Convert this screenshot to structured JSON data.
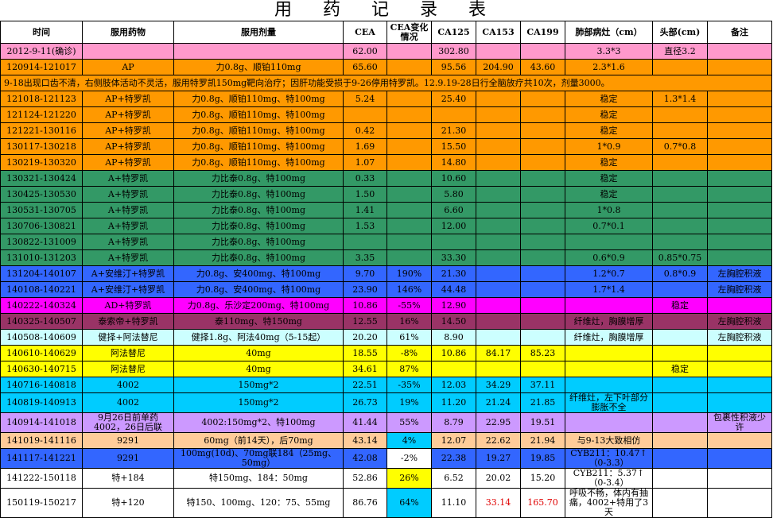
{
  "title": "用 药 记 录 表",
  "headers": [
    "时间",
    "服用药物",
    "服用剂量",
    "CEA",
    "CEA变化情况",
    "CA125",
    "CA153",
    "CA199",
    "肺部病灶（cm）",
    "头部(cm)",
    "备注"
  ],
  "colors": {
    "pink": "#ff99cc",
    "orange": "#ff9900",
    "green": "#339966",
    "blue": "#3366ff",
    "magenta": "#ff00ff",
    "plum": "#993366",
    "lightcyan": "#ccffff",
    "yellow": "#ffff00",
    "cyan": "#00ccff",
    "lavender": "#cc99ff",
    "peach": "#ffcc99",
    "white": "#ffffff"
  },
  "rows": [
    {
      "bg": "pink",
      "cells": [
        "2012-9-11(确诊)",
        "",
        "",
        "62.00",
        "",
        "302.80",
        "",
        "",
        "3.3*3",
        "直径3.2",
        ""
      ]
    },
    {
      "bg": "orange",
      "cells": [
        "120914-121017",
        "AP",
        "力0.8g、顺铂110mg",
        "65.60",
        "",
        "95.56",
        "204.90",
        "43.60",
        "2.3*1.6",
        "",
        ""
      ]
    },
    {
      "bg": "orange",
      "note": "9-18出现口齿不清，右侧肢体活动不灵活，服用特罗凯150mg靶向治疗；因肝功能受损于9-26停用特罗凯。12.9.19-28日行全脑放疗共10次，剂量3000。"
    },
    {
      "bg": "orange",
      "cells": [
        "121018-121123",
        "AP+特罗凯",
        "力0.8g、顺铂110mg、特100mg",
        "5.24",
        "",
        "25.40",
        "",
        "",
        "稳定",
        "1.3*1.4",
        ""
      ]
    },
    {
      "bg": "orange",
      "cells": [
        "121124-121220",
        "AP+特罗凯",
        "力0.8g、顺铂110mg、特100mg",
        "",
        "",
        "",
        "",
        "",
        "稳定",
        "",
        ""
      ]
    },
    {
      "bg": "orange",
      "cells": [
        "121221-130116",
        "AP+特罗凯",
        "力0.8g、顺铂110mg、特100mg",
        "0.42",
        "",
        "21.30",
        "",
        "",
        "稳定",
        "",
        ""
      ]
    },
    {
      "bg": "orange",
      "cells": [
        "130117-130218",
        "AP+特罗凯",
        "力0.8g、顺铂110mg、特100mg",
        "1.69",
        "",
        "15.50",
        "",
        "",
        "1*0.9",
        "0.7*0.8",
        ""
      ]
    },
    {
      "bg": "orange",
      "cells": [
        "130219-130320",
        "AP+特罗凯",
        "力0.8g、顺铂110mg、特100mg",
        "1.07",
        "",
        "14.80",
        "",
        "",
        "稳定",
        "",
        ""
      ]
    },
    {
      "bg": "green",
      "cells": [
        "130321-130424",
        "A+特罗凯",
        "力比泰0.8g、特100mg",
        "0.33",
        "",
        "10.60",
        "",
        "",
        "稳定",
        "",
        ""
      ]
    },
    {
      "bg": "green",
      "cells": [
        "130425-130530",
        "A+特罗凯",
        "力比泰0.8g、特100mg",
        "1.50",
        "",
        "5.80",
        "",
        "",
        "稳定",
        "",
        ""
      ]
    },
    {
      "bg": "green",
      "cells": [
        "130531-130705",
        "A+特罗凯",
        "力比泰0.8g、特100mg",
        "1.41",
        "",
        "6.60",
        "",
        "",
        "1*0.8",
        "",
        ""
      ]
    },
    {
      "bg": "green",
      "cells": [
        "130706-130821",
        "A+特罗凯",
        "力比泰0.8g、特100mg",
        "1.53",
        "",
        "12.00",
        "",
        "",
        "0.7*0.1",
        "",
        ""
      ]
    },
    {
      "bg": "green",
      "cells": [
        "130822-131009",
        "A+特罗凯",
        "力比泰0.8g、特100mg",
        "",
        "",
        "",
        "",
        "",
        "",
        "",
        ""
      ]
    },
    {
      "bg": "green",
      "cells": [
        "131010-131203",
        "A+特罗凯",
        "力比泰0.8g、特100mg",
        "3.35",
        "",
        "33.30",
        "",
        "",
        "0.6*0.9",
        "0.85*0.75",
        ""
      ]
    },
    {
      "bg": "blue",
      "cells": [
        "131204-140107",
        "A+安维汀+特罗凯",
        "力0.8g、安400mg、特100mg",
        "9.70",
        "190%",
        "21.30",
        "",
        "",
        "1.2*0.7",
        "0.8*0.9",
        "左胸腔积液"
      ]
    },
    {
      "bg": "blue",
      "cells": [
        "140108-140221",
        "A+安维汀+特罗凯",
        "力0.8g、安400mg、特100mg",
        "23.90",
        "146%",
        "44.48",
        "",
        "",
        "1.7*1.4",
        "",
        "左胸腔积液"
      ]
    },
    {
      "bg": "magenta",
      "cells": [
        "140222-140324",
        "AD+特罗凯",
        "力0.8g、乐沙定200mg、特100mg",
        "10.86",
        "-55%",
        "12.90",
        "",
        "",
        "",
        "稳定",
        ""
      ]
    },
    {
      "bg": "plum",
      "cells": [
        "140325-140507",
        "泰索帝+特罗凯",
        "泰110mg、特150mg",
        "12.55",
        "16%",
        "14.50",
        "",
        "",
        "纤维灶，胸膜增厚",
        "",
        "左胸腔积液"
      ]
    },
    {
      "bg": "lightcyan",
      "cells": [
        "140508-140609",
        "健择+阿法替尼",
        "健择1.8g、阿法40mg（5-15起）",
        "20.20",
        "61%",
        "8.90",
        "",
        "",
        "纤维灶，胸膜增厚",
        "",
        "左胸腔积液"
      ]
    },
    {
      "bg": "yellow",
      "cells": [
        "140610-140629",
        "阿法替尼",
        "40mg",
        "18.55",
        "-8%",
        "10.86",
        "84.17",
        "85.23",
        "",
        "",
        ""
      ]
    },
    {
      "bg": "yellow",
      "cells": [
        "140630-140715",
        "阿法替尼",
        "40mg",
        "34.61",
        "87%",
        "",
        "",
        "",
        "",
        "稳定",
        ""
      ]
    },
    {
      "bg": "cyan",
      "cells": [
        "140716-140818",
        "4002",
        "150mg*2",
        "22.51",
        "-35%",
        "12.03",
        "34.29",
        "37.11",
        "",
        "",
        ""
      ]
    },
    {
      "bg": "cyan",
      "cells": [
        "140819-140913",
        "4002",
        "150mg*2",
        "26.73",
        "19%",
        "11.20",
        "21.24",
        "21.85",
        "纤维灶，左下叶部分膨胀不全",
        "",
        ""
      ]
    },
    {
      "bg": "lavender",
      "cells": [
        "140914-141018",
        "9月26日前单药4002，26日后联",
        "4002:150mg*2、特100mg",
        "41.44",
        "55%",
        "8.79",
        "22.95",
        "19.51",
        "",
        "",
        "包裹性积液少许"
      ]
    },
    {
      "bg": "peach",
      "cells": [
        "141019-141116",
        "9291",
        "60mg（前14天），后70mg",
        "43.14",
        "4%",
        "12.07",
        "22.62",
        "21.94",
        "与9-13大致相仿",
        "",
        ""
      ]
    },
    {
      "bg": "blue",
      "cells": [
        "141117-141221",
        "9291",
        "100mg(10d)、70mg联184（25mg、50mg）",
        "42.08",
        "-2%",
        "22.38",
        "19.27",
        "19.85",
        "CYB211：10.47↑（0-3.3）",
        "",
        ""
      ]
    },
    {
      "bg": "white",
      "cells": [
        "141222-150118",
        "特+184",
        "特150mg、184：50mg",
        "52.86",
        "26%",
        "6.52",
        "20.02",
        "15.20",
        "CYB211：5.37↑（0-3.4）",
        "",
        ""
      ]
    },
    {
      "bg": "white",
      "cells": [
        "150119-150217",
        "特+120",
        "特150、100mg、120：75、55mg",
        "86.76",
        "64%",
        "11.10",
        "33.14",
        "165.70",
        "呼吸不畅，体内有抽痛，4002+特用了3天",
        "",
        ""
      ]
    }
  ]
}
